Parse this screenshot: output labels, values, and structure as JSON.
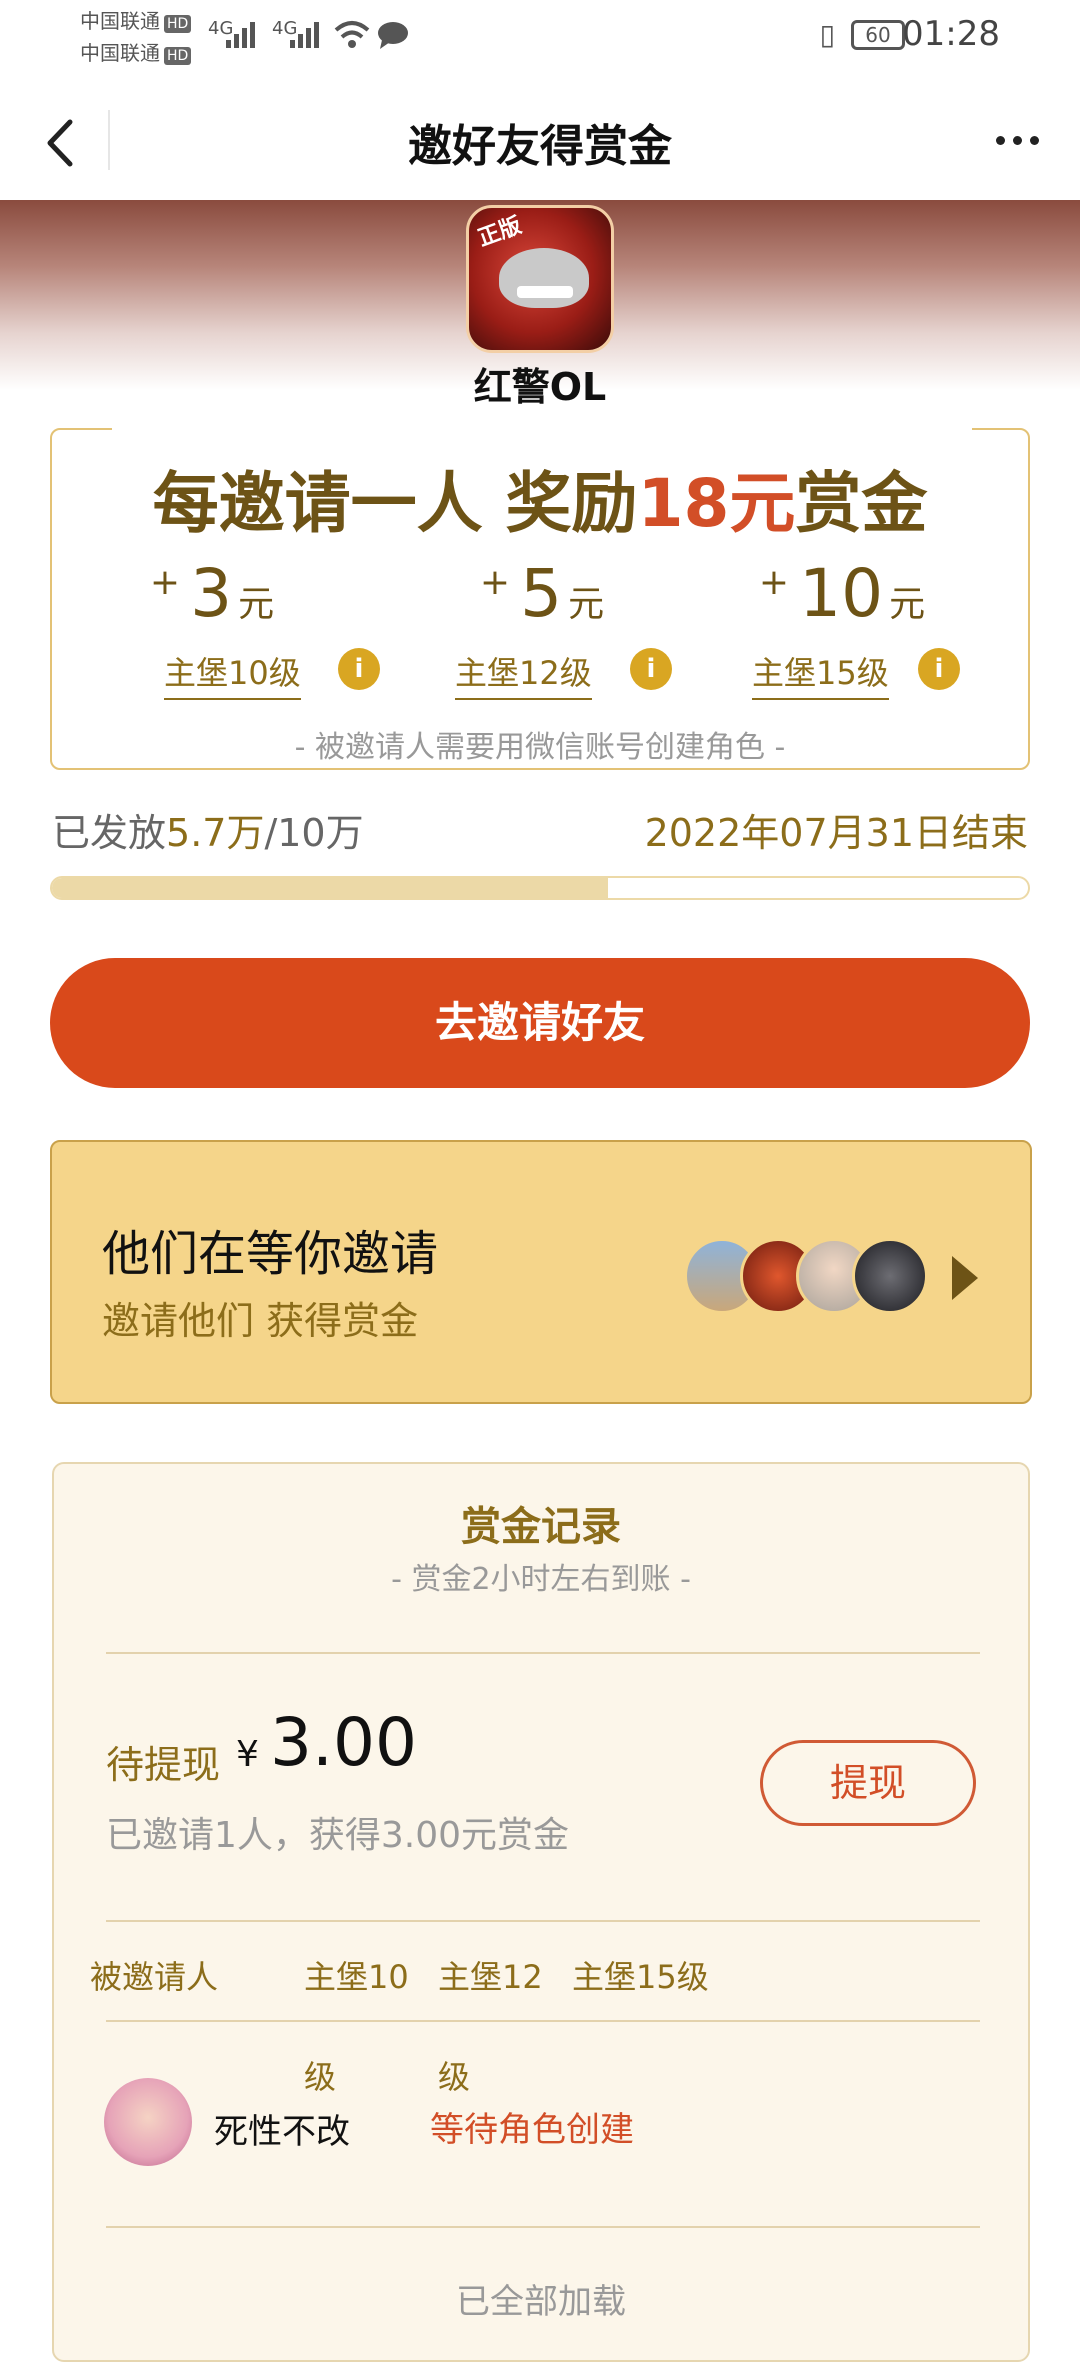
{
  "status_bar": {
    "carrier_1": "中国联通",
    "carrier_2": "中国联通",
    "hd_label": "HD",
    "network_1": "4G",
    "network_2": "4G",
    "battery": "60",
    "time": "01:28"
  },
  "nav": {
    "title": "邀好友得赏金"
  },
  "game": {
    "name": "红警OL",
    "icon_tag": "正版"
  },
  "reward": {
    "headline_pre": "每邀请一人 奖励",
    "headline_amount": "18元",
    "headline_post": "赏金",
    "tiers": [
      {
        "amount": "3",
        "unit": "元",
        "label": "主堡10级"
      },
      {
        "amount": "5",
        "unit": "元",
        "label": "主堡12级"
      },
      {
        "amount": "10",
        "unit": "元",
        "label": "主堡15级"
      }
    ],
    "plus": "+",
    "info": "i",
    "note": "- 被邀请人需要用微信账号创建角色 -"
  },
  "progress": {
    "issued_label": "已发放",
    "issued": "5.7万",
    "total": "/10万",
    "deadline": "2022年07月31日结束",
    "fraction": 0.57
  },
  "invite_button": "去邀请好友",
  "waiting": {
    "title": "他们在等你邀请",
    "subtitle": "邀请他们 获得赏金"
  },
  "record": {
    "title": "赏金记录",
    "subtitle": "- 赏金2小时左右到账 -",
    "pending_label": "待提现",
    "currency": "¥",
    "pending_amount": "3.00",
    "summary": "已邀请1人，获得3.00元赏金",
    "withdraw": "提现",
    "headers": [
      "被邀请人",
      "主堡10",
      "主堡12",
      "主堡15级"
    ],
    "header_overflow": [
      "级",
      "级"
    ],
    "rows": [
      {
        "name": "死性不改",
        "status": "等待角色创建"
      }
    ],
    "all_loaded": "已全部加载"
  },
  "colors": {
    "accent": "#d9491b",
    "gold_text": "#8c6d1a",
    "waiting_bg": "#f5d58a",
    "record_bg": "#fcf6ea"
  }
}
